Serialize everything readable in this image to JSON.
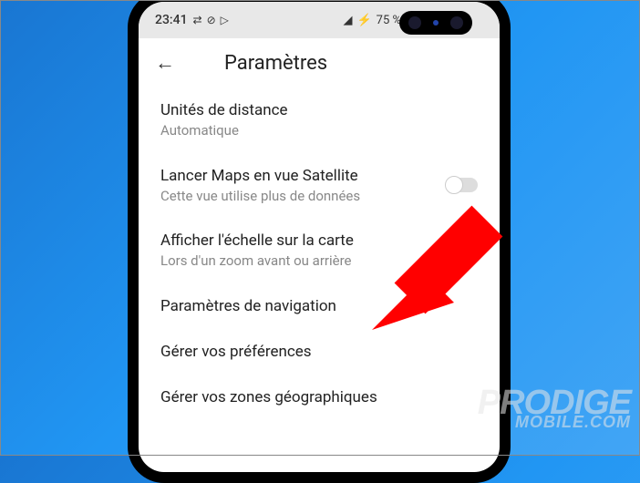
{
  "statusBar": {
    "time": "23:41",
    "battery": "75 %"
  },
  "header": {
    "title": "Paramètres"
  },
  "settings": {
    "distance": {
      "title": "Unités de distance",
      "subtitle": "Automatique"
    },
    "satellite": {
      "title": "Lancer Maps en vue Satellite",
      "subtitle": "Cette vue utilise plus de données"
    },
    "scale": {
      "title": "Afficher l'échelle sur la carte",
      "subtitle": "Lors d'un zoom avant ou arrière"
    },
    "navigation": {
      "title": "Paramètres de navigation"
    },
    "preferences": {
      "title": "Gérer vos préférences"
    },
    "zones": {
      "title": "Gérer vos zones géographiques"
    }
  },
  "watermark": {
    "line1": "PRODIGE",
    "line2": "MOBILE.COM"
  },
  "annotation": {
    "arrow_color": "#ff0000"
  }
}
